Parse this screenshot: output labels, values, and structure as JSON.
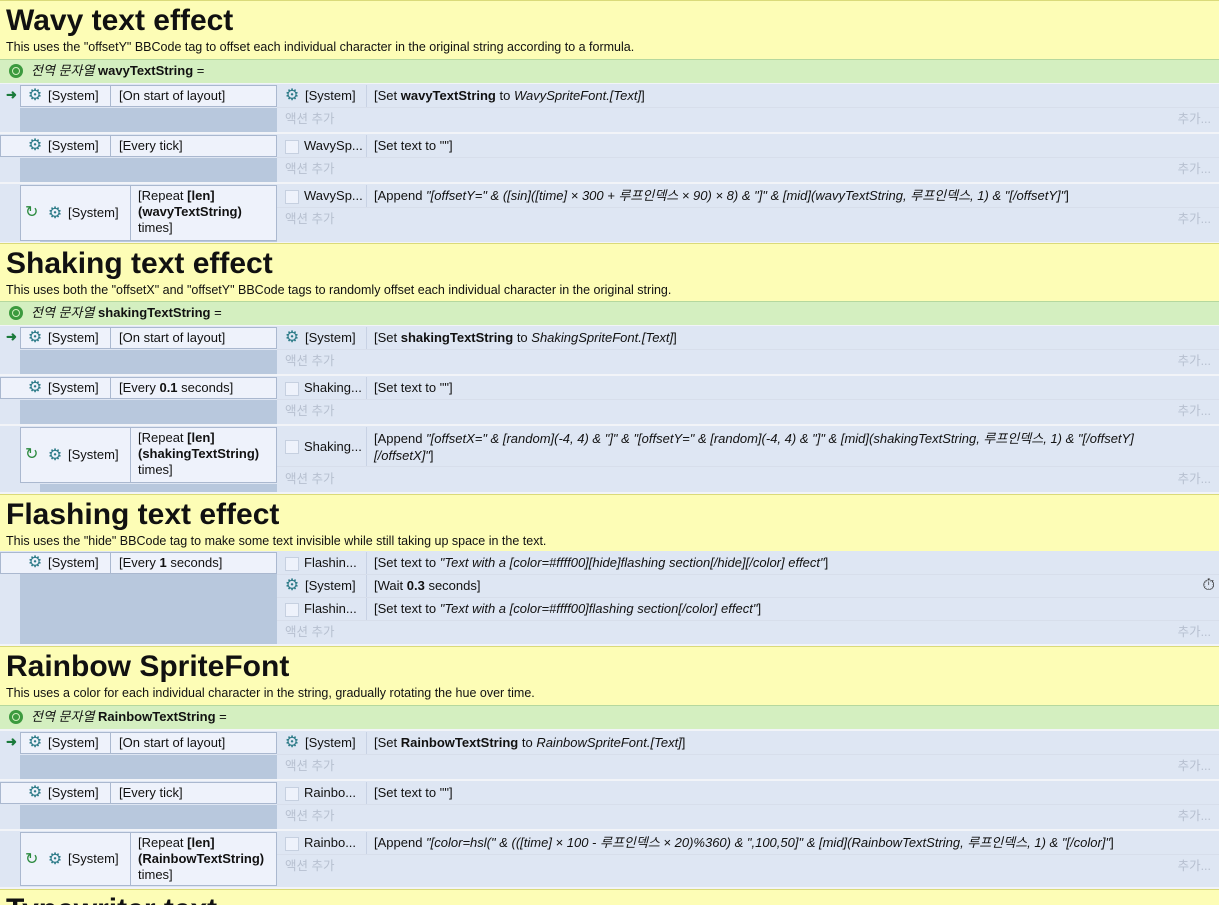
{
  "sections": {
    "wavy": {
      "title": "Wavy text effect",
      "desc": "This uses the \"offsetY\" BBCode tag to offset each individual character in the original string according to a formula.",
      "global_label": "전역 문자열",
      "global_name": "wavyTextString",
      "global_suffix": "=",
      "ev1_obj": "[System]",
      "ev1_cond": "[On start of layout]",
      "ev1_act_obj": "[System]",
      "ev1_act_pre": "[Set ",
      "ev1_act_var": "wavyTextString",
      "ev1_act_mid": " to ",
      "ev1_act_val": "WavySpriteFont.[Text]",
      "ev1_act_post": "]",
      "ev2_obj": "[System]",
      "ev2_cond": "[Every tick]",
      "ev2_act_obj": "WavySp...",
      "ev2_act": "[Set text to \"\"]",
      "ev3_obj": "[System]",
      "ev3_cond_pre": "[Repeat ",
      "ev3_cond_bold": "[len](wavyTextString)",
      "ev3_cond_post": "times]",
      "ev3_act_obj": "WavySp...",
      "ev3_act_pre": "[Append ",
      "ev3_act_expr": "\"[offsetY=\" & ([sin]([time] × 300 + 루프인덱스 × 90) × 8) & \"]\" & [mid](wavyTextString, 루프인덱스, 1) & \"[/offsetY]\"",
      "ev3_act_post": "]"
    },
    "shaking": {
      "title": "Shaking text effect",
      "desc": "This uses both the \"offsetX\" and \"offsetY\" BBCode tags to randomly offset each individual character in the original string.",
      "global_label": "전역 문자열",
      "global_name": "shakingTextString",
      "global_suffix": "=",
      "ev1_obj": "[System]",
      "ev1_cond": "[On start of layout]",
      "ev1_act_obj": "[System]",
      "ev1_act_pre": "[Set ",
      "ev1_act_var": "shakingTextString",
      "ev1_act_mid": " to ",
      "ev1_act_val": "ShakingSpriteFont.[Text]",
      "ev1_act_post": "]",
      "ev2_obj": "[System]",
      "ev2_cond_pre": "[Every ",
      "ev2_cond_bold": "0.1",
      "ev2_cond_post": " seconds]",
      "ev2_act_obj": "Shaking...",
      "ev2_act": "[Set text to \"\"]",
      "ev3_obj": "[System]",
      "ev3_cond_pre": "[Repeat ",
      "ev3_cond_bold": "[len](shakingTextString)",
      "ev3_cond_post": "times]",
      "ev3_act_obj": "Shaking...",
      "ev3_act_pre": "[Append ",
      "ev3_act_expr1": "\"[offsetX=\" & [random](-4, 4) & \"]\" & \"[offsetY=\" & [random](-4, 4) & \"]\" & [mid](shakingTextString, 루프인덱스, 1) & \"[/offsetY]",
      "ev3_act_expr2": "[/offsetX]\"",
      "ev3_act_post": "]"
    },
    "flashing": {
      "title": "Flashing text effect",
      "desc": "This uses the \"hide\" BBCode tag to make some text invisible while still taking up space in the text.",
      "ev1_obj": "[System]",
      "ev1_cond_pre": "[Every ",
      "ev1_cond_bold": "1",
      "ev1_cond_post": " seconds]",
      "act1_obj": "Flashin...",
      "act1_pre": "[Set text to ",
      "act1_val": "\"Text with a [color=#ffff00][hide]flashing section[/hide][/color] effect\"",
      "act1_post": "]",
      "act2_obj": "[System]",
      "act2_pre": "[Wait ",
      "act2_bold": "0.3",
      "act2_post": " seconds]",
      "act3_obj": "Flashin...",
      "act3_pre": "[Set text to ",
      "act3_val": "\"Text with a [color=#ffff00]flashing section[/color] effect\"",
      "act3_post": "]"
    },
    "rainbow": {
      "title": "Rainbow SpriteFont",
      "desc": "This uses a color for each individual character in the string, gradually rotating the hue over time.",
      "global_label": "전역 문자열",
      "global_name": "RainbowTextString",
      "global_suffix": "=",
      "ev1_obj": "[System]",
      "ev1_cond": "[On start of layout]",
      "ev1_act_obj": "[System]",
      "ev1_act_pre": "[Set ",
      "ev1_act_var": "RainbowTextString",
      "ev1_act_mid": " to ",
      "ev1_act_val": "RainbowSpriteFont.[Text]",
      "ev1_act_post": "]",
      "ev2_obj": "[System]",
      "ev2_cond": "[Every tick]",
      "ev2_act_obj": "Rainbo...",
      "ev2_act": "[Set text to \"\"]",
      "ev3_obj": "[System]",
      "ev3_cond_pre": "[Repeat ",
      "ev3_cond_bold": "[len](RainbowTextString)",
      "ev3_cond_post": "times]",
      "ev3_act_obj": "Rainbo...",
      "ev3_act_pre": "[Append ",
      "ev3_act_expr": "\"[color=hsl(\" & (([time] × 100 - 루프인덱스 × 20)%360) & \",100,50]\" & [mid](RainbowTextString, 루프인덱스, 1) & \"[/color]\"",
      "ev3_act_post": "]"
    },
    "typewriter": {
      "title": "Typewriter text"
    }
  },
  "add_action": "액션 추가",
  "more": "추가..."
}
